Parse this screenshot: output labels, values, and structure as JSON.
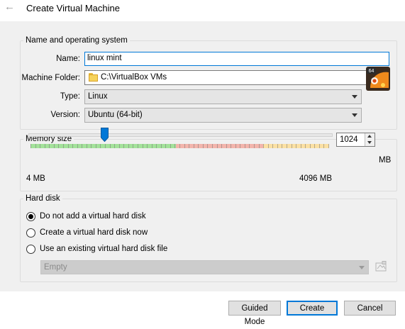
{
  "window": {
    "title": "Create Virtual Machine"
  },
  "name_os": {
    "legend": "Name and operating system",
    "name_label": "Name:",
    "name_value": "linux mint",
    "folder_label": "Machine Folder:",
    "folder_value": "C:\\VirtualBox VMs",
    "type_label": "Type:",
    "type_value": "Linux",
    "version_label": "Version:",
    "version_value": "Ubuntu (64-bit)",
    "os_badge": "64"
  },
  "memory": {
    "legend": "Memory size",
    "value": "1024",
    "unit": "MB",
    "min_label": "4 MB",
    "max_label": "4096 MB",
    "slider_fraction": 0.25
  },
  "hard_disk": {
    "legend": "Hard disk",
    "options": [
      {
        "label": "Do not add a virtual hard disk",
        "checked": true
      },
      {
        "label": "Create a virtual hard disk now",
        "checked": false
      },
      {
        "label": "Use an existing virtual hard disk file",
        "checked": false
      }
    ],
    "existing_file_value": "Empty"
  },
  "buttons": {
    "guided_mode": "Guided Mode",
    "create": "Create",
    "cancel": "Cancel"
  },
  "colors": {
    "accent": "#0078d7",
    "zone_green": "#a3e29a",
    "zone_red": "#f3b5ac",
    "zone_yellow": "#fbe0a3"
  }
}
